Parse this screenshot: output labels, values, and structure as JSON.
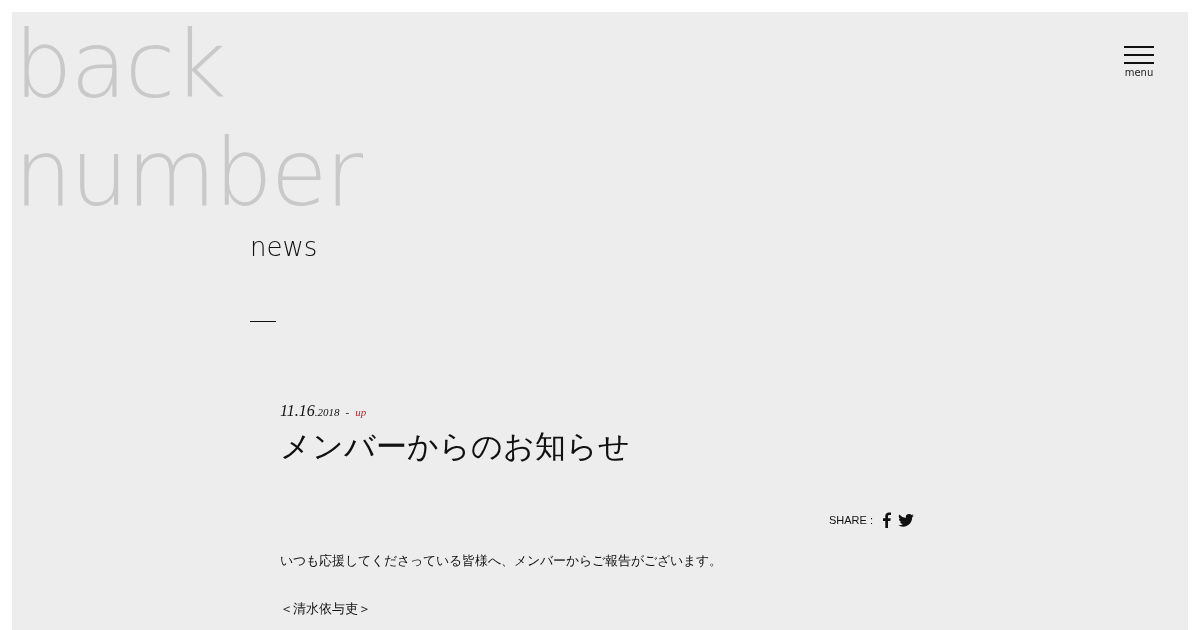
{
  "logo": {
    "lines": [
      "back",
      "number"
    ]
  },
  "menu": {
    "label": "menu"
  },
  "section": {
    "title": "news"
  },
  "article": {
    "date": "11.16",
    "year": ".2018",
    "separator": "-",
    "status": "up",
    "title": "メンバーからのお知らせ",
    "share_label": "SHARE :",
    "paragraphs": [
      "いつも応援してくださっている皆様へ、メンバーからご報告がございます。",
      "＜清水依与吏＞"
    ]
  }
}
